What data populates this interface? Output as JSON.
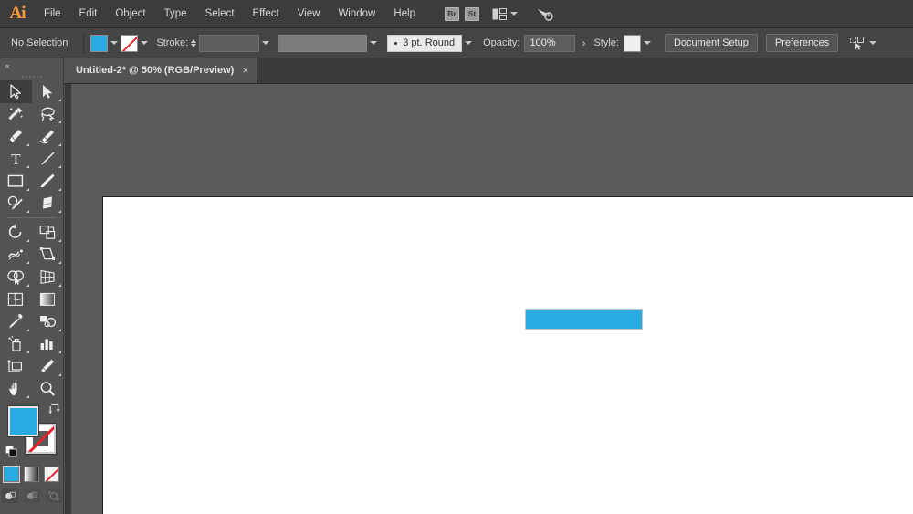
{
  "app": {
    "name": "Adobe Illustrator",
    "logo_text": "Ai"
  },
  "menubar": {
    "items": [
      {
        "label": "File"
      },
      {
        "label": "Edit"
      },
      {
        "label": "Object"
      },
      {
        "label": "Type"
      },
      {
        "label": "Select"
      },
      {
        "label": "Effect"
      },
      {
        "label": "View"
      },
      {
        "label": "Window"
      },
      {
        "label": "Help"
      }
    ],
    "bridge_badge": "Br",
    "stock_badge": "St",
    "arrange_documents_icon": "arrange-documents-icon",
    "workspace_switcher_icon": "workspace-switcher-icon"
  },
  "controlbar": {
    "selection_status": "No Selection",
    "fill_swatch_color": "#29abe2",
    "stroke_swatch_value": "None",
    "stroke_label": "Stroke:",
    "stroke_weight_value": "",
    "variable_width_profile_value": "",
    "brush_definition": "3 pt. Round",
    "opacity_label": "Opacity:",
    "opacity_value": "100%",
    "style_label": "Style:",
    "style_swatch_color": "#efefef",
    "document_setup_label": "Document Setup",
    "preferences_label": "Preferences",
    "select_similar_icon": "select-similar-objects-icon",
    "more_options_chevron": "›"
  },
  "tabbar": {
    "document_title": "Untitled-2* @ 50% (RGB/Preview)",
    "close_glyph": "×"
  },
  "toolbar": {
    "collapse_glyph": "«",
    "tools": [
      {
        "name": "selection-tool",
        "active": true
      },
      {
        "name": "direct-selection-tool",
        "active": false
      },
      {
        "name": "magic-wand-tool",
        "active": false
      },
      {
        "name": "lasso-tool",
        "active": false
      },
      {
        "name": "pen-tool",
        "active": false
      },
      {
        "name": "curvature-tool",
        "active": false
      },
      {
        "name": "type-tool",
        "active": false
      },
      {
        "name": "line-segment-tool",
        "active": false
      },
      {
        "name": "rectangle-tool",
        "active": false
      },
      {
        "name": "paintbrush-tool",
        "active": false
      },
      {
        "name": "shaper-tool",
        "active": false
      },
      {
        "name": "eraser-tool",
        "active": false
      },
      {
        "name": "rotate-tool",
        "active": false
      },
      {
        "name": "scale-tool",
        "active": false
      },
      {
        "name": "width-tool",
        "active": false
      },
      {
        "name": "free-transform-tool",
        "active": false
      },
      {
        "name": "shape-builder-tool",
        "active": false
      },
      {
        "name": "perspective-grid-tool",
        "active": false
      },
      {
        "name": "mesh-tool",
        "active": false
      },
      {
        "name": "gradient-tool",
        "active": false
      },
      {
        "name": "eyedropper-tool",
        "active": false
      },
      {
        "name": "blend-tool",
        "active": false
      },
      {
        "name": "symbol-sprayer-tool",
        "active": false
      },
      {
        "name": "column-graph-tool",
        "active": false
      },
      {
        "name": "artboard-tool",
        "active": false
      },
      {
        "name": "slice-tool",
        "active": false
      },
      {
        "name": "hand-tool",
        "active": false
      },
      {
        "name": "zoom-tool",
        "active": false
      }
    ],
    "fill_color": "#29abe2",
    "stroke_color": "None",
    "swap_fill_stroke_icon": "swap-fill-stroke-icon",
    "default_fill_stroke_icon": "default-fill-stroke-icon",
    "color_modes": [
      {
        "name": "color-mode-button",
        "selected": true
      },
      {
        "name": "gradient-mode-button",
        "selected": false
      },
      {
        "name": "none-mode-button",
        "selected": false
      }
    ],
    "drawing_modes": [
      {
        "name": "draw-normal-button",
        "selected": true
      },
      {
        "name": "draw-behind-button",
        "selected": false
      },
      {
        "name": "draw-inside-button",
        "selected": false
      }
    ]
  },
  "canvas": {
    "artboard_background": "#ffffff",
    "workspace_background": "#5a5a5a",
    "shape": {
      "name": "blue-rectangle",
      "fill": "#29abe2"
    }
  }
}
